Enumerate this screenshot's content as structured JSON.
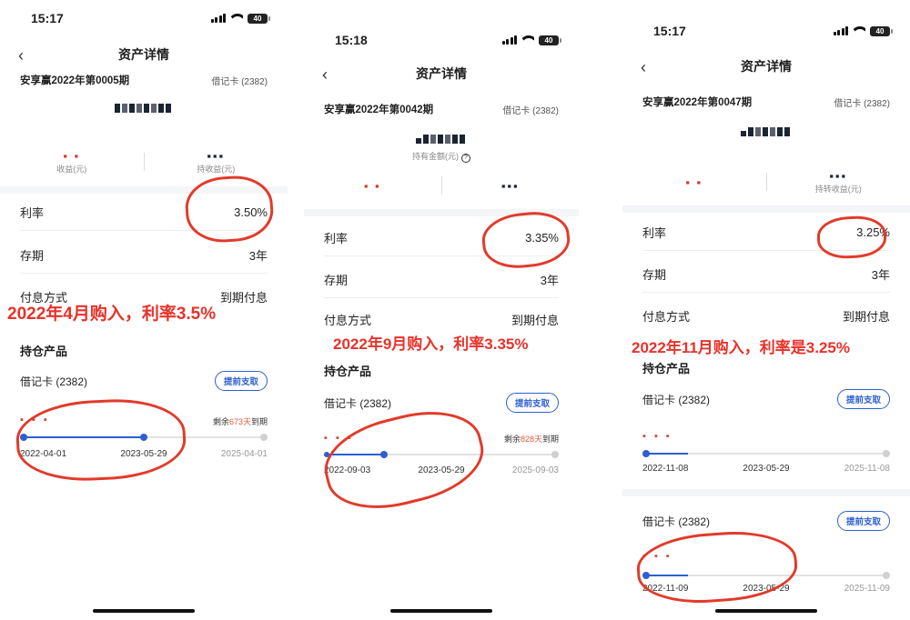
{
  "panels": [
    {
      "time": "15:17",
      "battery": "40",
      "title": "资产详情",
      "product": "安享赢2022年第0005期",
      "card": "借记卡 (2382)",
      "amount_label": "",
      "rate_label": "利率",
      "rate": "3.50%",
      "term_label": "存期",
      "term": "3年",
      "pay_label": "付息方式",
      "pay": "到期付息",
      "hold_title": "持仓产品",
      "holding": [
        {
          "card": "借记卡 (2382)",
          "btn": "提前支取",
          "remain_pre": "剩余",
          "remain_days": "673天",
          "remain_post": "到期",
          "start": "2022-04-01",
          "now": "2023-05-29",
          "end": "2025-04-01",
          "progress": 0.5
        }
      ],
      "stat_left_label": "收益(元)",
      "stat_right_label": "持收益(元)",
      "overlay": "2022年4月购入，利率3.5%"
    },
    {
      "time": "15:18",
      "battery": "40",
      "title": "资产详情",
      "product": "安享赢2022年第0042期",
      "card": "借记卡 (2382)",
      "amount_label": "持有金额(元)",
      "rate_label": "利率",
      "rate": "3.35%",
      "term_label": "存期",
      "term": "3年",
      "pay_label": "付息方式",
      "pay": "到期付息",
      "hold_title": "持仓产品",
      "holding": [
        {
          "card": "借记卡 (2382)",
          "btn": "提前支取",
          "remain_pre": "剩余",
          "remain_days": "828天",
          "remain_post": "到期",
          "start": "2022-09-03",
          "now": "2023-05-29",
          "end": "2025-09-03",
          "progress": 0.25
        }
      ],
      "stat_left_label": "",
      "stat_right_label": "",
      "overlay": "2022年9月购入，利率3.35%"
    },
    {
      "time": "15:17",
      "battery": "40",
      "title": "资产详情",
      "product": "安享赢2022年第0047期",
      "card": "借记卡 (2382)",
      "amount_label": "",
      "rate_label": "利率",
      "rate": "3.25%",
      "term_label": "存期",
      "term": "3年",
      "pay_label": "付息方式",
      "pay": "到期付息",
      "hold_title": "持仓产品",
      "holding": [
        {
          "card": "借记卡 (2382)",
          "btn": "提前支取",
          "start": "2022-11-08",
          "now": "2023-05-29",
          "end": "2025-11-08",
          "progress": 0.18
        },
        {
          "card": "借记卡 (2382)",
          "btn": "提前支取",
          "start": "2022-11-09",
          "now": "2023-05-29",
          "end": "2025-11-09",
          "progress": 0.18
        }
      ],
      "stat_left_label": "",
      "stat_right_label": "持转收益(元)",
      "overlay": "2022年11月购入，利率是3.25%"
    }
  ],
  "colors": {
    "accent": "#2d5fd0",
    "annotation": "#e8322a",
    "remain_days": "#e05a3b"
  }
}
